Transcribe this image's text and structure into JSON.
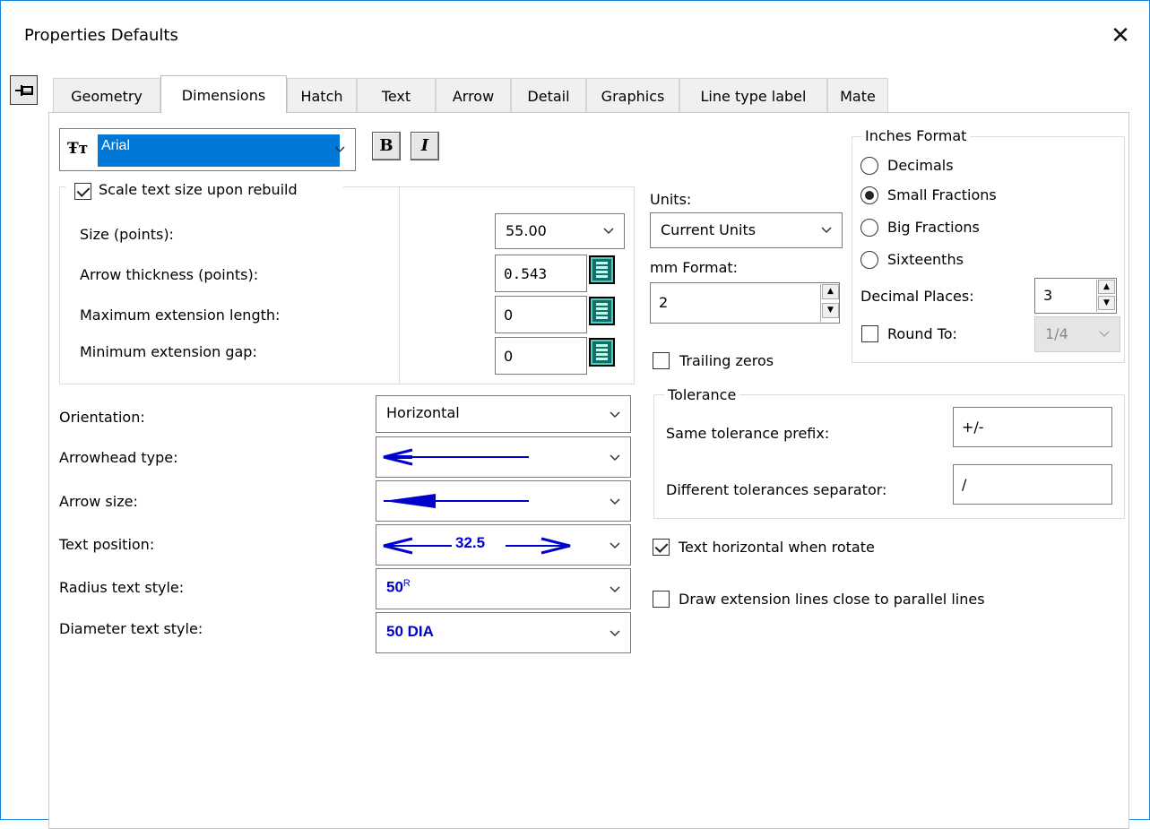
{
  "window": {
    "title": "Properties Defaults",
    "close_glyph": "✕"
  },
  "tabs": [
    "Geometry",
    "Dimensions",
    "Hatch",
    "Text",
    "Arrow",
    "Detail",
    "Graphics",
    "Line type label",
    "Mate"
  ],
  "active_tab": "Dimensions",
  "font": {
    "value": "Arial",
    "bold_label": "B",
    "italic_label": "I"
  },
  "scale_group": {
    "checkbox_label": "Scale text size upon rebuild",
    "checked": true,
    "rows": [
      {
        "label": "Size (points):",
        "value": "55.00"
      },
      {
        "label": "Arrow thickness (points):",
        "value": "0.543"
      },
      {
        "label": "Maximum extension length:",
        "value": "0"
      },
      {
        "label": "Minimum extension gap:",
        "value": "0"
      }
    ]
  },
  "styles": [
    {
      "label": "Orientation:",
      "value": "Horizontal"
    },
    {
      "label": "Arrowhead type:",
      "value": ""
    },
    {
      "label": "Arrow size:",
      "value": ""
    },
    {
      "label": "Text position:",
      "value": "32.5"
    },
    {
      "label": "Radius text style:",
      "value": "50",
      "sup": "R"
    },
    {
      "label": "Diameter text style:",
      "value": "50 DIA"
    }
  ],
  "units": {
    "label": "Units:",
    "value": "Current Units",
    "mm_label": "mm Format:",
    "mm_value": "2",
    "trailing_zeros_label": "Trailing zeros",
    "trailing_zeros_checked": false
  },
  "inches": {
    "title": "Inches Format",
    "options": [
      "Decimals",
      "Small Fractions",
      "Big Fractions",
      "Sixteenths"
    ],
    "selected": "Small Fractions",
    "decimal_label": "Decimal Places:",
    "decimal_value": "3",
    "round_label": "Round To:",
    "round_value": "1/4",
    "round_checked": false
  },
  "tolerance": {
    "title": "Tolerance",
    "same_label": "Same tolerance prefix:",
    "same_value": "+/-",
    "diff_label": "Different tolerances separator:",
    "diff_value": "/"
  },
  "options": {
    "text_horizontal_label": "Text horizontal when rotate",
    "text_horizontal_checked": true,
    "draw_ext_label": "Draw extension lines close to parallel lines",
    "draw_ext_checked": false
  },
  "colors": {
    "accent": "#0078d7",
    "dimension_blue": "#0000cc"
  }
}
